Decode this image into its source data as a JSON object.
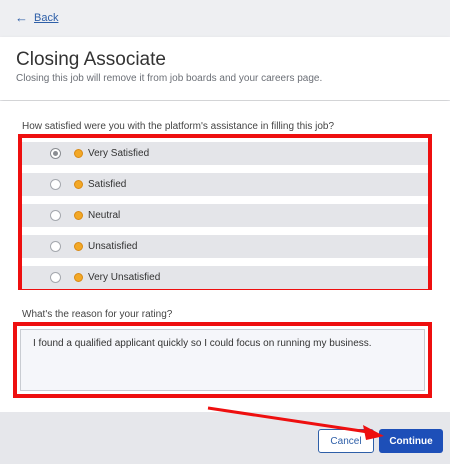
{
  "nav": {
    "back_label": "Back",
    "back_icon": "arrow-left-icon"
  },
  "header": {
    "title": "Closing Associate",
    "subtitle": "Closing this job will remove it from job boards and your careers page."
  },
  "survey": {
    "question": "How satisfied were you with the platform's assistance in filling this job?",
    "selected_index": 0,
    "options": [
      {
        "label": "Very Satisfied",
        "icon": "very-satisfied-emoji-icon"
      },
      {
        "label": "Satisfied",
        "icon": "satisfied-emoji-icon"
      },
      {
        "label": "Neutral",
        "icon": "neutral-emoji-icon"
      },
      {
        "label": "Unsatisfied",
        "icon": "unsatisfied-emoji-icon"
      },
      {
        "label": "Very Unsatisfied",
        "icon": "very-unsatisfied-emoji-icon"
      }
    ]
  },
  "reason": {
    "question": "What's the reason for your rating?",
    "value": "I found a qualified applicant quickly so I could focus on running my business."
  },
  "footer": {
    "cancel_label": "Cancel",
    "continue_label": "Continue"
  },
  "colors": {
    "accent": "#1d4fb8",
    "highlight": "#ee0f0f",
    "option_bg": "#e4e5e9"
  }
}
